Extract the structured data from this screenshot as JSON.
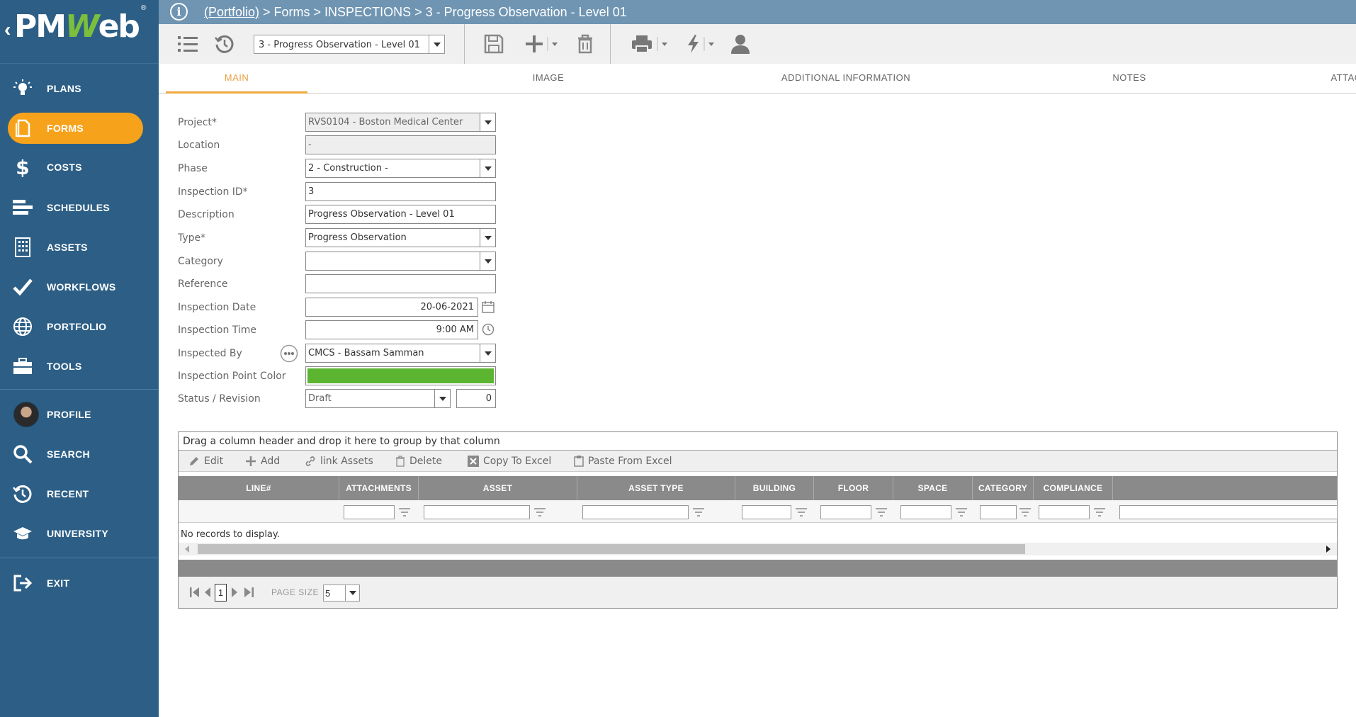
{
  "logo": {
    "text_pm": "PM",
    "text_w": "W",
    "text_eb": "eb",
    "back_arrow": "‹",
    "registered": "®"
  },
  "topbar": {
    "info_icon": "i",
    "breadcrumb_link": "(Portfolio)",
    "breadcrumb_rest": " > Forms > INSPECTIONS > 3 - Progress Observation - Level 01"
  },
  "toolbar": {
    "record_select_value": "3 - Progress Observation - Level 01"
  },
  "sidebar": {
    "items": [
      {
        "label": "PLANS",
        "icon": "lightbulb-icon"
      },
      {
        "label": "FORMS",
        "icon": "document-icon"
      },
      {
        "label": "COSTS",
        "icon": "dollar-icon"
      },
      {
        "label": "SCHEDULES",
        "icon": "gantt-icon"
      },
      {
        "label": "ASSETS",
        "icon": "building-icon"
      },
      {
        "label": "WORKFLOWS",
        "icon": "checkmark-icon"
      },
      {
        "label": "PORTFOLIO",
        "icon": "globe-icon"
      },
      {
        "label": "TOOLS",
        "icon": "toolbox-icon"
      },
      {
        "label": "PROFILE",
        "icon": "avatar"
      },
      {
        "label": "SEARCH",
        "icon": "search-icon"
      },
      {
        "label": "RECENT",
        "icon": "history-icon"
      },
      {
        "label": "UNIVERSITY",
        "icon": "graduation-cap-icon"
      },
      {
        "label": "EXIT",
        "icon": "exit-icon"
      }
    ],
    "active_color": "#f7a21b",
    "bg_color": "#2d5f86"
  },
  "tabs": [
    "MAIN",
    "IMAGE",
    "ADDITIONAL INFORMATION",
    "NOTES",
    "ATTACHMENTS"
  ],
  "form": {
    "project_label": "Project*",
    "project_value": "RVS0104 - Boston Medical Center",
    "location_label": "Location",
    "location_value": "-",
    "phase_label": "Phase",
    "phase_value": "2 - Construction -",
    "inspection_id_label": "Inspection ID*",
    "inspection_id_value": "3",
    "description_label": "Description",
    "description_value": "Progress Observation - Level 01",
    "type_label": "Type*",
    "type_value": "Progress Observation",
    "category_label": "Category",
    "category_value": "",
    "reference_label": "Reference",
    "reference_value": "",
    "inspection_date_label": "Inspection Date",
    "inspection_date_value": "20-06-2021",
    "inspection_time_label": "Inspection Time",
    "inspection_time_value": "9:00 AM",
    "inspected_by_label": "Inspected By",
    "inspected_by_value": "CMCS - Bassam Samman",
    "point_color_label": "Inspection Point Color",
    "point_color_value": "#5cb531",
    "status_label": "Status / Revision",
    "status_value": "Draft",
    "revision_value": "0"
  },
  "grid": {
    "group_hint": "Drag a column header and drop it here to group by that column",
    "buttons": {
      "edit": "Edit",
      "add": "Add",
      "link_assets": "link Assets",
      "delete": "Delete",
      "copy_excel": "Copy To Excel",
      "paste_excel": "Paste From Excel"
    },
    "columns": [
      "LINE#",
      "ATTACHMENTS",
      "ASSET",
      "ASSET TYPE",
      "BUILDING",
      "FLOOR",
      "SPACE",
      "CATEGORY",
      "COMPLIANCE"
    ],
    "no_records": "No records to display.",
    "pager": {
      "current_page": "1",
      "page_size_label": "PAGE SIZE",
      "page_size_value": "5"
    }
  }
}
